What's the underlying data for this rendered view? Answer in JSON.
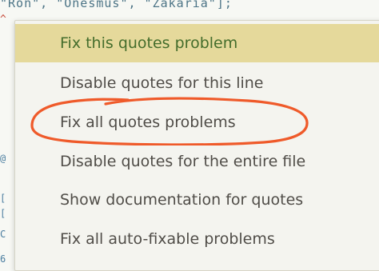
{
  "editor": {
    "code_line_top": "\"Ron\", \"Onesmus\", \"Zakaria\"];"
  },
  "context_menu": {
    "items": [
      {
        "label": "Fix this quotes problem",
        "state": "highlighted"
      },
      {
        "label": "Disable quotes for this line",
        "state": "normal"
      },
      {
        "label": "Fix all quotes problems",
        "state": "circled"
      },
      {
        "label": "Disable quotes for the entire file",
        "state": "normal"
      },
      {
        "label": "Show documentation for quotes",
        "state": "normal"
      },
      {
        "label": "Fix all auto-fixable problems",
        "state": "normal"
      }
    ]
  },
  "annotation": {
    "color": "#ef5a2a",
    "target": "Fix all quotes problems",
    "icon": "hand-drawn-circle"
  },
  "colors": {
    "highlight_background": "#e5d99b",
    "highlight_text": "#446d2c",
    "menu_text": "#504d48",
    "menu_background": "#f4f4ef",
    "error_squiggle": "#d9534f"
  }
}
